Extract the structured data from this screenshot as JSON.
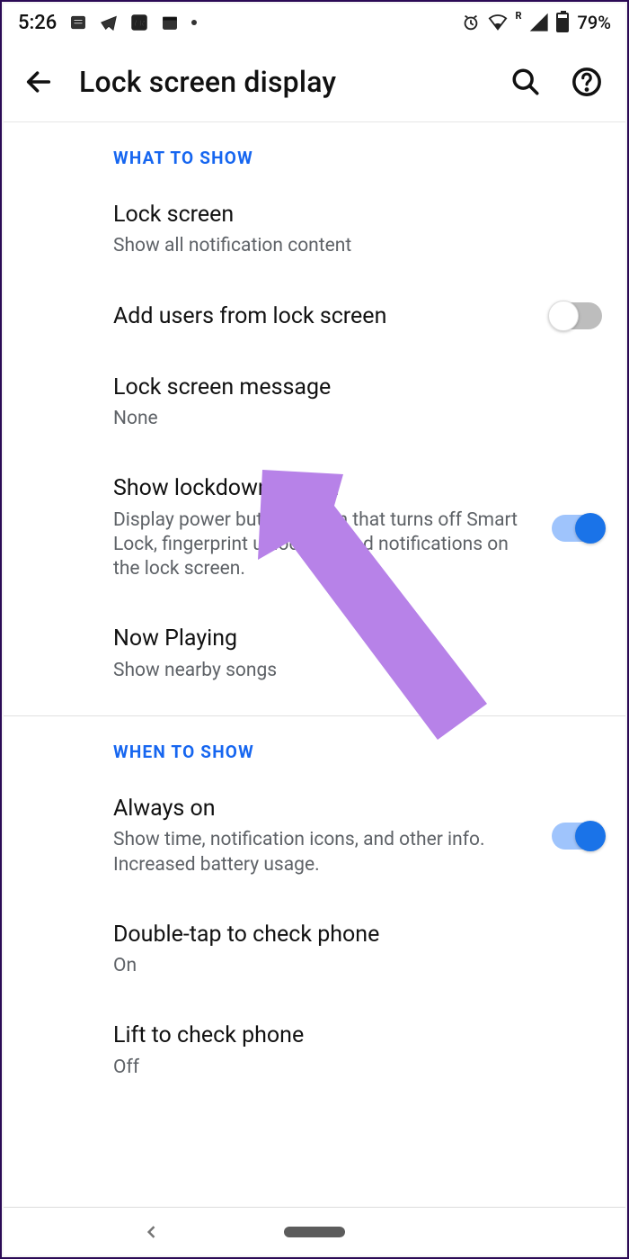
{
  "statusbar": {
    "time": "5:26",
    "battery_pct": "79%"
  },
  "appbar": {
    "title": "Lock screen display"
  },
  "sections": [
    {
      "header": "WHAT TO SHOW",
      "items": [
        {
          "title": "Lock screen",
          "sub": "Show all notification content"
        },
        {
          "title": "Add users from lock screen",
          "sub": ""
        },
        {
          "title": "Lock screen message",
          "sub": "None"
        },
        {
          "title": "Show lockdown option",
          "sub": "Display power button option that turns off Smart Lock, fingerprint unlocking, and notifications on the lock screen."
        },
        {
          "title": "Now Playing",
          "sub": "Show nearby songs"
        }
      ]
    },
    {
      "header": "WHEN TO SHOW",
      "items": [
        {
          "title": "Always on",
          "sub": "Show time, notification icons, and other info. Increased battery usage."
        },
        {
          "title": "Double-tap to check phone",
          "sub": "On"
        },
        {
          "title": "Lift to check phone",
          "sub": "Off"
        }
      ]
    }
  ]
}
